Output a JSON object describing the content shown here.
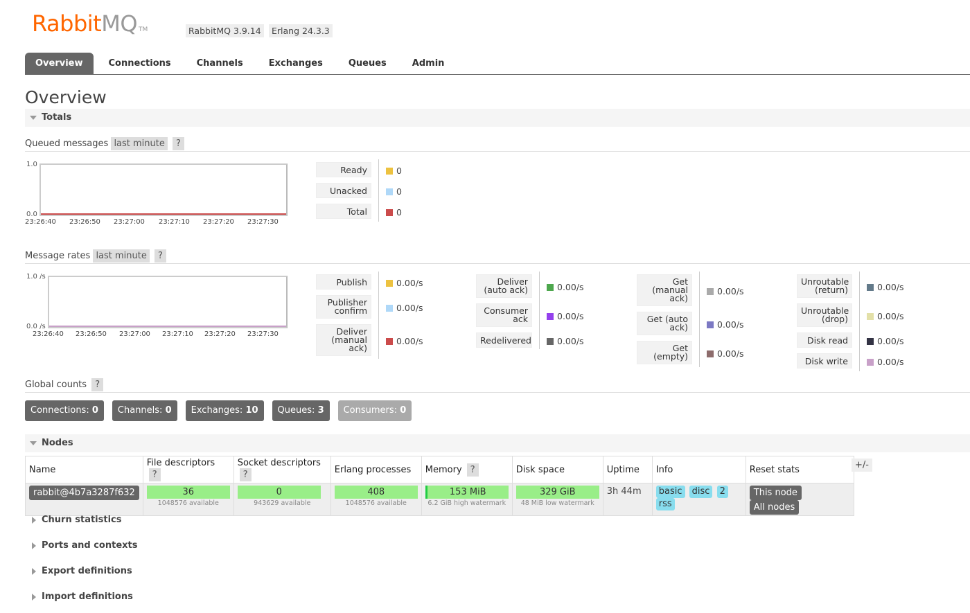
{
  "header": {
    "logo_main": "Rabbit",
    "logo_mq": "MQ",
    "logo_tm": "TM",
    "rabbitmq_version": "RabbitMQ 3.9.14",
    "erlang_version": "Erlang 24.3.3"
  },
  "tabs": [
    "Overview",
    "Connections",
    "Channels",
    "Exchanges",
    "Queues",
    "Admin"
  ],
  "page_title": "Overview",
  "totals": {
    "section_label": "Totals",
    "queued": {
      "title": "Queued messages",
      "period": "last minute",
      "help": "?",
      "y_top": "1.0",
      "y_bottom": "0.0",
      "x_ticks": [
        "23:26:40",
        "23:26:50",
        "23:27:00",
        "23:27:10",
        "23:27:20",
        "23:27:30"
      ],
      "legend": [
        {
          "label": "Ready",
          "value": "0",
          "color": "#edc240"
        },
        {
          "label": "Unacked",
          "value": "0",
          "color": "#afd8f8"
        },
        {
          "label": "Total",
          "value": "0",
          "color": "#cb4b4b"
        }
      ]
    },
    "rates": {
      "title": "Message rates",
      "period": "last minute",
      "help": "?",
      "y_top": "1.0 /s",
      "y_bottom": "0.0 /s",
      "x_ticks": [
        "23:26:40",
        "23:26:50",
        "23:27:00",
        "23:27:10",
        "23:27:20",
        "23:27:30"
      ],
      "col1": [
        {
          "label": "Publish",
          "value": "0.00/s",
          "color": "#edc240"
        },
        {
          "label": "Publisher confirm",
          "value": "0.00/s",
          "color": "#afd8f8"
        },
        {
          "label": "Deliver (manual ack)",
          "value": "0.00/s",
          "color": "#cb4b4b"
        }
      ],
      "col2": [
        {
          "label": "Deliver (auto ack)",
          "value": "0.00/s",
          "color": "#4da74d"
        },
        {
          "label": "Consumer ack",
          "value": "0.00/s",
          "color": "#9440ed"
        },
        {
          "label": "Redelivered",
          "value": "0.00/s",
          "color": "#666666"
        }
      ],
      "col3": [
        {
          "label": "Get (manual ack)",
          "value": "0.00/s",
          "color": "#aaaaaa"
        },
        {
          "label": "Get (auto ack)",
          "value": "0.00/s",
          "color": "#7c79c3"
        },
        {
          "label": "Get (empty)",
          "value": "0.00/s",
          "color": "#8d6c6c"
        }
      ],
      "col4": [
        {
          "label": "Unroutable (return)",
          "value": "0.00/s",
          "color": "#637a8a"
        },
        {
          "label": "Unroutable (drop)",
          "value": "0.00/s",
          "color": "#e3e0a8"
        },
        {
          "label": "Disk read",
          "value": "0.00/s",
          "color": "#333344"
        },
        {
          "label": "Disk write",
          "value": "0.00/s",
          "color": "#c8a0c8"
        }
      ]
    },
    "global": {
      "title": "Global counts",
      "help": "?",
      "counts": [
        {
          "label": "Connections:",
          "value": "0"
        },
        {
          "label": "Channels:",
          "value": "0"
        },
        {
          "label": "Exchanges:",
          "value": "10"
        },
        {
          "label": "Queues:",
          "value": "3"
        },
        {
          "label": "Consumers:",
          "value": "0"
        }
      ]
    }
  },
  "nodes": {
    "section_label": "Nodes",
    "headers": {
      "name": "Name",
      "fd": "File descriptors",
      "sd": "Socket descriptors",
      "ep": "Erlang processes",
      "mem": "Memory",
      "disk": "Disk space",
      "uptime": "Uptime",
      "info": "Info",
      "reset": "Reset stats"
    },
    "help": "?",
    "plus_minus": "+/-",
    "row": {
      "name": "rabbit@4b7a3287f632",
      "fd": "36",
      "fd_sub": "1048576 available",
      "sd": "0",
      "sd_sub": "943629 available",
      "ep": "408",
      "ep_sub": "1048576 available",
      "mem": "153 MiB",
      "mem_sub": "6.2 GiB high watermark",
      "disk": "329 GiB",
      "disk_sub": "48 MiB low watermark",
      "uptime": "3h 44m",
      "info_tags": [
        "basic",
        "disc",
        "2",
        "rss"
      ],
      "reset_this": "This node",
      "reset_all": "All nodes"
    }
  },
  "collapsed_sections": [
    "Churn statistics",
    "Ports and contexts",
    "Export definitions",
    "Import definitions"
  ]
}
